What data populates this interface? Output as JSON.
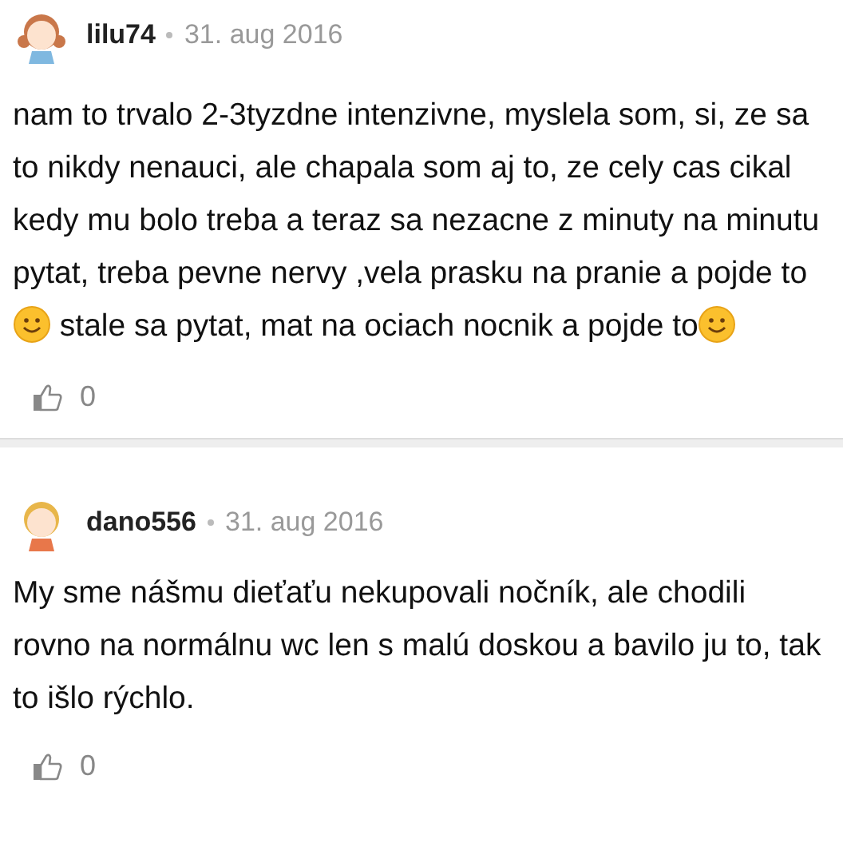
{
  "comments": [
    {
      "author": "lilu74",
      "date": "31. aug 2016",
      "avatar": {
        "kind": "girl"
      },
      "body": [
        {
          "kind": "text",
          "text": "nam to trvalo 2-3tyzdne intenzivne, myslela som, si, ze sa to nikdy nenauci, ale chapala som aj to, ze cely cas cikal kedy mu bolo treba a teraz sa nezacne z minuty na minutu pytat, treba pevne nervy ,vela prasku na pranie a pojde to"
        },
        {
          "kind": "smiley"
        },
        {
          "kind": "text",
          "text": " stale sa pytat, mat na ociach nocnik a pojde to"
        },
        {
          "kind": "smiley"
        }
      ],
      "likes": "0"
    },
    {
      "author": "dano556",
      "date": "31. aug 2016",
      "avatar": {
        "kind": "boy"
      },
      "body": [
        {
          "kind": "text",
          "text": "My sme nášmu dieťaťu nekupovali nočník, ale chodili rovno na normálnu wc len s malú doskou a bavilo ju to, tak to išlo rýchlo."
        }
      ],
      "likes": "0"
    }
  ]
}
